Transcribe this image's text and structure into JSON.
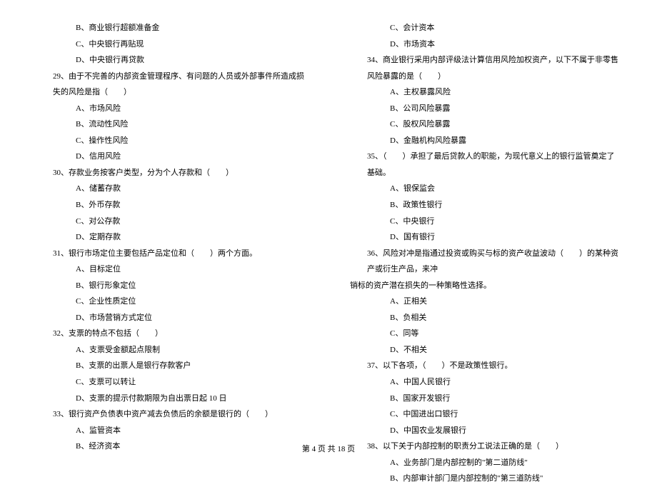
{
  "left": {
    "l0": "B、商业银行超额准备金",
    "l1": "C、中央银行再贴现",
    "l2": "D、中央银行再贷款",
    "q29": "29、由于不完善的内部资金管理程序、有问题的人员或外部事件所造成损失的风险是指（　　）",
    "q29a": "A、市场风险",
    "q29b": "B、流动性风险",
    "q29c": "C、操作性风险",
    "q29d": "D、信用风险",
    "q30": "30、存款业务按客户类型，分为个人存款和（　　）",
    "q30a": "A、储蓄存款",
    "q30b": "B、外币存款",
    "q30c": "C、对公存款",
    "q30d": "D、定期存款",
    "q31": "31、银行市场定位主要包括产品定位和（　　）两个方面。",
    "q31a": "A、目标定位",
    "q31b": "B、银行形象定位",
    "q31c": "C、企业性质定位",
    "q31d": "D、市场营销方式定位",
    "q32": "32、支票的特点不包括（　　）",
    "q32a": "A、支票受金额起点限制",
    "q32b": "B、支票的出票人是银行存款客户",
    "q32c": "C、支票可以转让",
    "q32d": "D、支票的提示付款期限为自出票日起 10 日",
    "q33": "33、银行资产负债表中资产减去负债后的余额是银行的（　　）",
    "q33a": "A、监管资本",
    "q33b": "B、经济资本"
  },
  "right": {
    "r0": "C、会计资本",
    "r1": "D、市场资本",
    "q34": "34、商业银行采用内部评级法计算信用风险加权资产，以下不属于非零售风险暴露的是（　　）",
    "q34a": "A、主权暴露风险",
    "q34b": "B、公司风险暴露",
    "q34c": "C、股权风险暴露",
    "q34d": "D、金融机构风险暴露",
    "q35": "35、（　　）承担了最后贷款人的职能，为现代意义上的银行监管奠定了基础。",
    "q35a": "A、银保监会",
    "q35b": "B、政策性银行",
    "q35c": "C、中央银行",
    "q35d": "D、国有银行",
    "q36a_line1": "36、风险对冲是指通过投资或购买与标的资产收益波动（　　）的某种资产或衍生产品，来冲",
    "q36a_line2": "销标的资产潜在损失的一种策略性选择。",
    "q36aa": "A、正相关",
    "q36ab": "B、负相关",
    "q36ac": "C、同等",
    "q36ad": "D、不相关",
    "q37": "37、以下各项，（　　）不是政策性银行。",
    "q37a": "A、中国人民银行",
    "q37b": "B、国家开发银行",
    "q37c": "C、中国进出口银行",
    "q37d": "D、中国农业发展银行",
    "q38": "38、以下关于内部控制的职责分工说法正确的是（　　）",
    "q38a": "A、业务部门是内部控制的\"第二道防线\"",
    "q38b": "B、内部审计部门是内部控制的\"第三道防线\""
  },
  "footer": "第 4 页 共 18 页"
}
